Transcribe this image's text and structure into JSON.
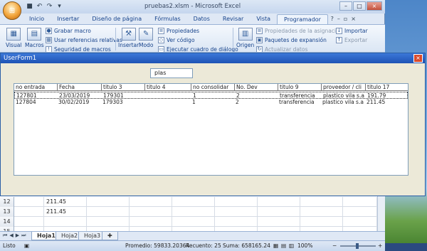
{
  "window": {
    "title": "pruebas2.xlsm - Microsoft Excel",
    "min": "–",
    "max": "□",
    "close": "×"
  },
  "ribbon": {
    "tabs": [
      "Inicio",
      "Insertar",
      "Diseño de página",
      "Fórmulas",
      "Datos",
      "Revisar",
      "Vista",
      "Programador"
    ],
    "active_tab": "Programador",
    "help": "?",
    "group_code": {
      "visual": "Visual",
      "macros": "Macros",
      "grabar": "Grabar macro",
      "referencias": "Usar referencias relativas",
      "seguridad": "Seguridad de macros"
    },
    "group_controls": {
      "insertar": "Insertar",
      "modo": "Modo",
      "propiedades": "Propiedades",
      "ver_codigo": "Ver código",
      "ejecutar": "Ejecutar cuadro de diálogo"
    },
    "group_xml": {
      "origen": "Origen",
      "prop_asignacion": "Propiedades de la asignación",
      "paquetes": "Paquetes de expansión",
      "actualizar": "Actualizar datos",
      "importar": "Importar",
      "exportar": "Exportar"
    }
  },
  "sheet": {
    "rows": [
      {
        "num": "12",
        "b": "211.45"
      },
      {
        "num": "13",
        "b": "211.45"
      },
      {
        "num": "14",
        "b": ""
      },
      {
        "num": "15",
        "b": ""
      }
    ],
    "tabs": [
      "Hoja1",
      "Hoja2",
      "Hoja3"
    ],
    "active_tab": "Hoja1"
  },
  "status": {
    "ready": "Listo",
    "promedio": "Promedio: 59833.20364",
    "recuento": "Recuento: 25",
    "suma": "Suma: 658165.24",
    "zoom": "100%",
    "zoom_minus": "−",
    "zoom_plus": "+"
  },
  "userform": {
    "title": "UserForm1",
    "close": "×",
    "search_value": "plas",
    "columns": [
      "no entrada",
      "Fecha",
      "titulo 3",
      "titulo 4",
      "no consolidar",
      "No. Dev",
      "titulo 9",
      "proveedor / cli",
      "titulo 17"
    ],
    "rows": [
      [
        "127801",
        "23/03/2019",
        "179301",
        "",
        "1",
        "2",
        "transferencia",
        "plastico vila s.a",
        "191.79"
      ],
      [
        "127804",
        "30/02/2019",
        "179303",
        "",
        "1",
        "2",
        "transferencia",
        "plastico vila s.a",
        "211.45"
      ]
    ]
  }
}
